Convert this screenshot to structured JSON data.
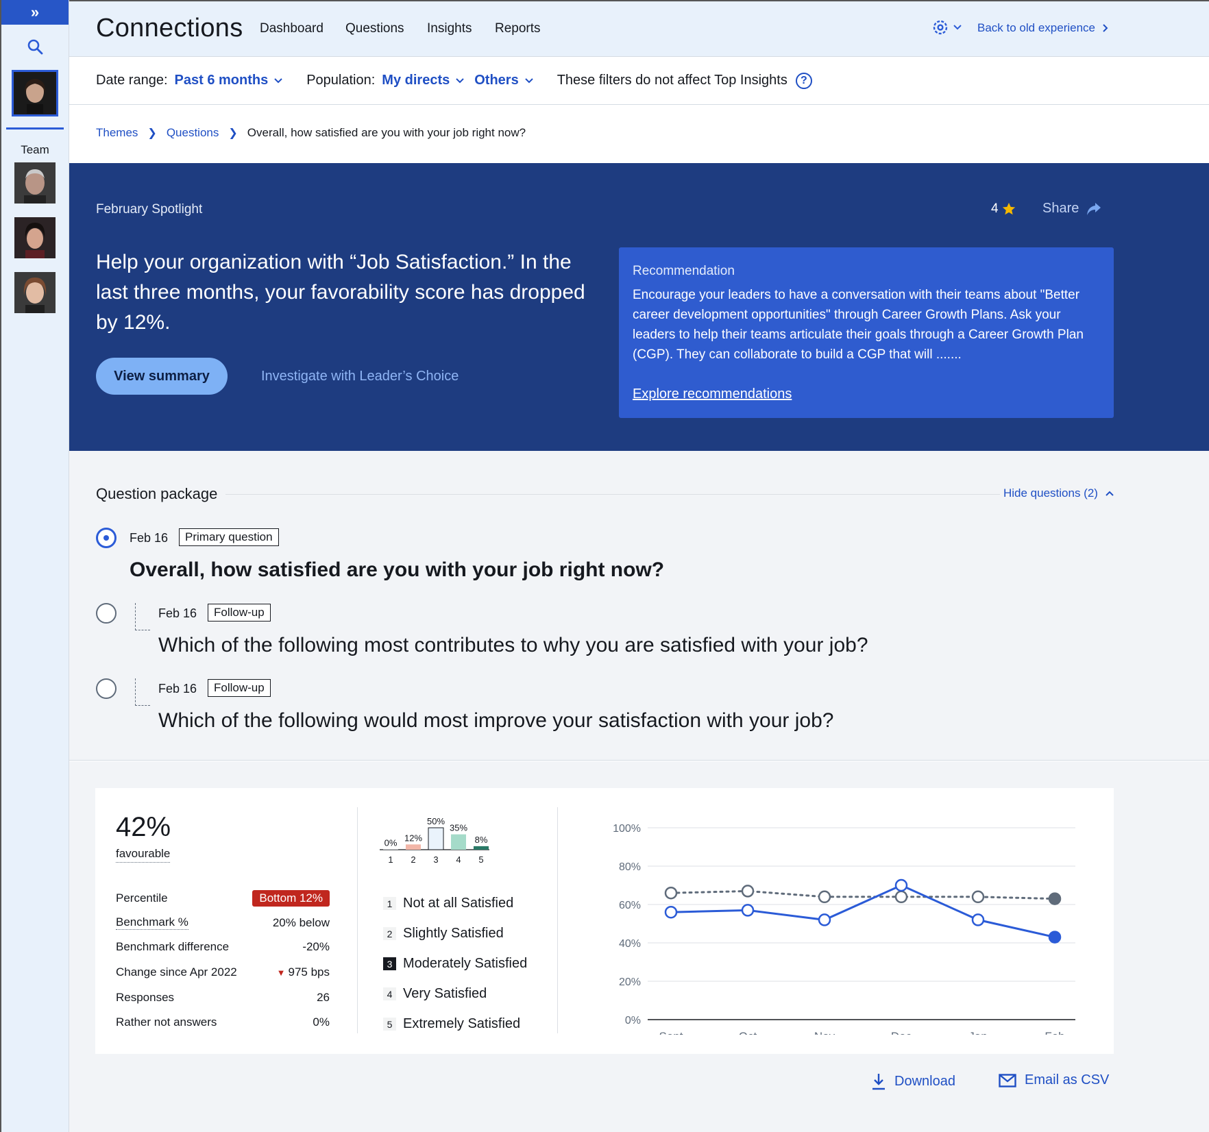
{
  "sidebar": {
    "expand_icon": "double-chevron-right-icon",
    "team_label": "Team"
  },
  "topnav": {
    "app_title": "Connections",
    "items": [
      "Dashboard",
      "Questions",
      "Insights",
      "Reports"
    ],
    "back_link": "Back to old experience"
  },
  "filters": {
    "date_label": "Date range:",
    "date_value": "Past 6 months",
    "population_label": "Population:",
    "population_value": "My directs",
    "others_value": "Others",
    "note": "These filters do not affect Top Insights"
  },
  "breadcrumb": {
    "themes": "Themes",
    "questions": "Questions",
    "current": "Overall, how satisfied are you with your job right now?"
  },
  "spotlight": {
    "label": "February Spotlight",
    "rating": "4",
    "share": "Share",
    "headline": "Help your organization with “Job Satisfaction.” In the last three months, your favorability score has dropped by 12%.",
    "view_summary": "View summary",
    "investigate": "Investigate with Leader’s Choice",
    "recommendation": {
      "title": "Recommendation",
      "body": "Encourage your leaders to have a conversation with their teams about \"Better career development opportunities\" through Career Growth Plans. Ask your leaders to help their teams articulate their goals through a Career Growth Plan (CGP). They can collaborate to build a CGP that will .......",
      "link": "Explore recommendations"
    }
  },
  "question_package": {
    "title": "Question package",
    "hide_label": "Hide questions (2)",
    "questions": [
      {
        "date": "Feb 16",
        "tag": "Primary question",
        "text": "Overall, how satisfied are you with your job right now?"
      },
      {
        "date": "Feb 16",
        "tag": "Follow-up",
        "text": "Which of the following most contributes to why you are satisfied with your job?"
      },
      {
        "date": "Feb 16",
        "tag": "Follow-up",
        "text": "Which of the following would most improve your satisfaction with your job?"
      }
    ]
  },
  "summary": {
    "big_pct": "42%",
    "fav_label": "favourable",
    "stats": [
      {
        "label": "Percentile",
        "value": "Bottom 12%"
      },
      {
        "label": "Benchmark %",
        "value": "20% below"
      },
      {
        "label": "Benchmark difference",
        "value": "-20%"
      },
      {
        "label": "Change since Apr 2022",
        "value": "975 bps"
      },
      {
        "label": "Responses",
        "value": "26"
      },
      {
        "label": "Rather not answers",
        "value": "0%"
      }
    ]
  },
  "legend": [
    {
      "num": "1",
      "label": "Not at all Satisfied"
    },
    {
      "num": "2",
      "label": "Slightly Satisfied"
    },
    {
      "num": "3",
      "label": "Moderately Satisfied"
    },
    {
      "num": "4",
      "label": "Very Satisfied"
    },
    {
      "num": "5",
      "label": "Extremely Satisfied"
    }
  ],
  "actions": {
    "download": "Download",
    "email": "Email as CSV"
  },
  "chart_data": [
    {
      "type": "bar",
      "categories": [
        "1",
        "2",
        "3",
        "4",
        "5"
      ],
      "values": [
        0,
        12,
        50,
        35,
        8
      ],
      "value_labels": [
        "0%",
        "12%",
        "50%",
        "35%",
        "8%"
      ],
      "colors": [
        "#c7cbd1",
        "#f2b6a8",
        "#eaf3fc",
        "#a5dbc9",
        "#2a7a67"
      ],
      "highlight_index": 2
    },
    {
      "type": "line",
      "categories": [
        "Sept",
        "Oct",
        "Nov",
        "Dec",
        "Jan",
        "Feb"
      ],
      "y_ticks": [
        "0%",
        "20%",
        "40%",
        "60%",
        "80%",
        "100%"
      ],
      "ylim": [
        0,
        100
      ],
      "grid": true,
      "series": [
        {
          "values": [
            66,
            67,
            64,
            64,
            64,
            63
          ],
          "style": "dotted",
          "color": "#5f6b7a"
        },
        {
          "values": [
            56,
            57,
            52,
            70,
            52,
            43
          ],
          "style": "solid",
          "color": "#2b5bd7"
        }
      ]
    }
  ]
}
